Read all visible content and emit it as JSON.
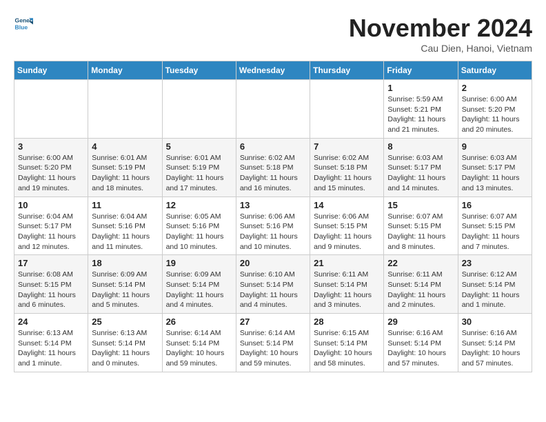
{
  "header": {
    "logo_line1": "General",
    "logo_line2": "Blue",
    "month": "November 2024",
    "location": "Cau Dien, Hanoi, Vietnam"
  },
  "weekdays": [
    "Sunday",
    "Monday",
    "Tuesday",
    "Wednesday",
    "Thursday",
    "Friday",
    "Saturday"
  ],
  "weeks": [
    [
      {
        "day": "",
        "info": ""
      },
      {
        "day": "",
        "info": ""
      },
      {
        "day": "",
        "info": ""
      },
      {
        "day": "",
        "info": ""
      },
      {
        "day": "",
        "info": ""
      },
      {
        "day": "1",
        "info": "Sunrise: 5:59 AM\nSunset: 5:21 PM\nDaylight: 11 hours and 21 minutes."
      },
      {
        "day": "2",
        "info": "Sunrise: 6:00 AM\nSunset: 5:20 PM\nDaylight: 11 hours and 20 minutes."
      }
    ],
    [
      {
        "day": "3",
        "info": "Sunrise: 6:00 AM\nSunset: 5:20 PM\nDaylight: 11 hours and 19 minutes."
      },
      {
        "day": "4",
        "info": "Sunrise: 6:01 AM\nSunset: 5:19 PM\nDaylight: 11 hours and 18 minutes."
      },
      {
        "day": "5",
        "info": "Sunrise: 6:01 AM\nSunset: 5:19 PM\nDaylight: 11 hours and 17 minutes."
      },
      {
        "day": "6",
        "info": "Sunrise: 6:02 AM\nSunset: 5:18 PM\nDaylight: 11 hours and 16 minutes."
      },
      {
        "day": "7",
        "info": "Sunrise: 6:02 AM\nSunset: 5:18 PM\nDaylight: 11 hours and 15 minutes."
      },
      {
        "day": "8",
        "info": "Sunrise: 6:03 AM\nSunset: 5:17 PM\nDaylight: 11 hours and 14 minutes."
      },
      {
        "day": "9",
        "info": "Sunrise: 6:03 AM\nSunset: 5:17 PM\nDaylight: 11 hours and 13 minutes."
      }
    ],
    [
      {
        "day": "10",
        "info": "Sunrise: 6:04 AM\nSunset: 5:17 PM\nDaylight: 11 hours and 12 minutes."
      },
      {
        "day": "11",
        "info": "Sunrise: 6:04 AM\nSunset: 5:16 PM\nDaylight: 11 hours and 11 minutes."
      },
      {
        "day": "12",
        "info": "Sunrise: 6:05 AM\nSunset: 5:16 PM\nDaylight: 11 hours and 10 minutes."
      },
      {
        "day": "13",
        "info": "Sunrise: 6:06 AM\nSunset: 5:16 PM\nDaylight: 11 hours and 10 minutes."
      },
      {
        "day": "14",
        "info": "Sunrise: 6:06 AM\nSunset: 5:15 PM\nDaylight: 11 hours and 9 minutes."
      },
      {
        "day": "15",
        "info": "Sunrise: 6:07 AM\nSunset: 5:15 PM\nDaylight: 11 hours and 8 minutes."
      },
      {
        "day": "16",
        "info": "Sunrise: 6:07 AM\nSunset: 5:15 PM\nDaylight: 11 hours and 7 minutes."
      }
    ],
    [
      {
        "day": "17",
        "info": "Sunrise: 6:08 AM\nSunset: 5:15 PM\nDaylight: 11 hours and 6 minutes."
      },
      {
        "day": "18",
        "info": "Sunrise: 6:09 AM\nSunset: 5:14 PM\nDaylight: 11 hours and 5 minutes."
      },
      {
        "day": "19",
        "info": "Sunrise: 6:09 AM\nSunset: 5:14 PM\nDaylight: 11 hours and 4 minutes."
      },
      {
        "day": "20",
        "info": "Sunrise: 6:10 AM\nSunset: 5:14 PM\nDaylight: 11 hours and 4 minutes."
      },
      {
        "day": "21",
        "info": "Sunrise: 6:11 AM\nSunset: 5:14 PM\nDaylight: 11 hours and 3 minutes."
      },
      {
        "day": "22",
        "info": "Sunrise: 6:11 AM\nSunset: 5:14 PM\nDaylight: 11 hours and 2 minutes."
      },
      {
        "day": "23",
        "info": "Sunrise: 6:12 AM\nSunset: 5:14 PM\nDaylight: 11 hours and 1 minute."
      }
    ],
    [
      {
        "day": "24",
        "info": "Sunrise: 6:13 AM\nSunset: 5:14 PM\nDaylight: 11 hours and 1 minute."
      },
      {
        "day": "25",
        "info": "Sunrise: 6:13 AM\nSunset: 5:14 PM\nDaylight: 11 hours and 0 minutes."
      },
      {
        "day": "26",
        "info": "Sunrise: 6:14 AM\nSunset: 5:14 PM\nDaylight: 10 hours and 59 minutes."
      },
      {
        "day": "27",
        "info": "Sunrise: 6:14 AM\nSunset: 5:14 PM\nDaylight: 10 hours and 59 minutes."
      },
      {
        "day": "28",
        "info": "Sunrise: 6:15 AM\nSunset: 5:14 PM\nDaylight: 10 hours and 58 minutes."
      },
      {
        "day": "29",
        "info": "Sunrise: 6:16 AM\nSunset: 5:14 PM\nDaylight: 10 hours and 57 minutes."
      },
      {
        "day": "30",
        "info": "Sunrise: 6:16 AM\nSunset: 5:14 PM\nDaylight: 10 hours and 57 minutes."
      }
    ]
  ]
}
